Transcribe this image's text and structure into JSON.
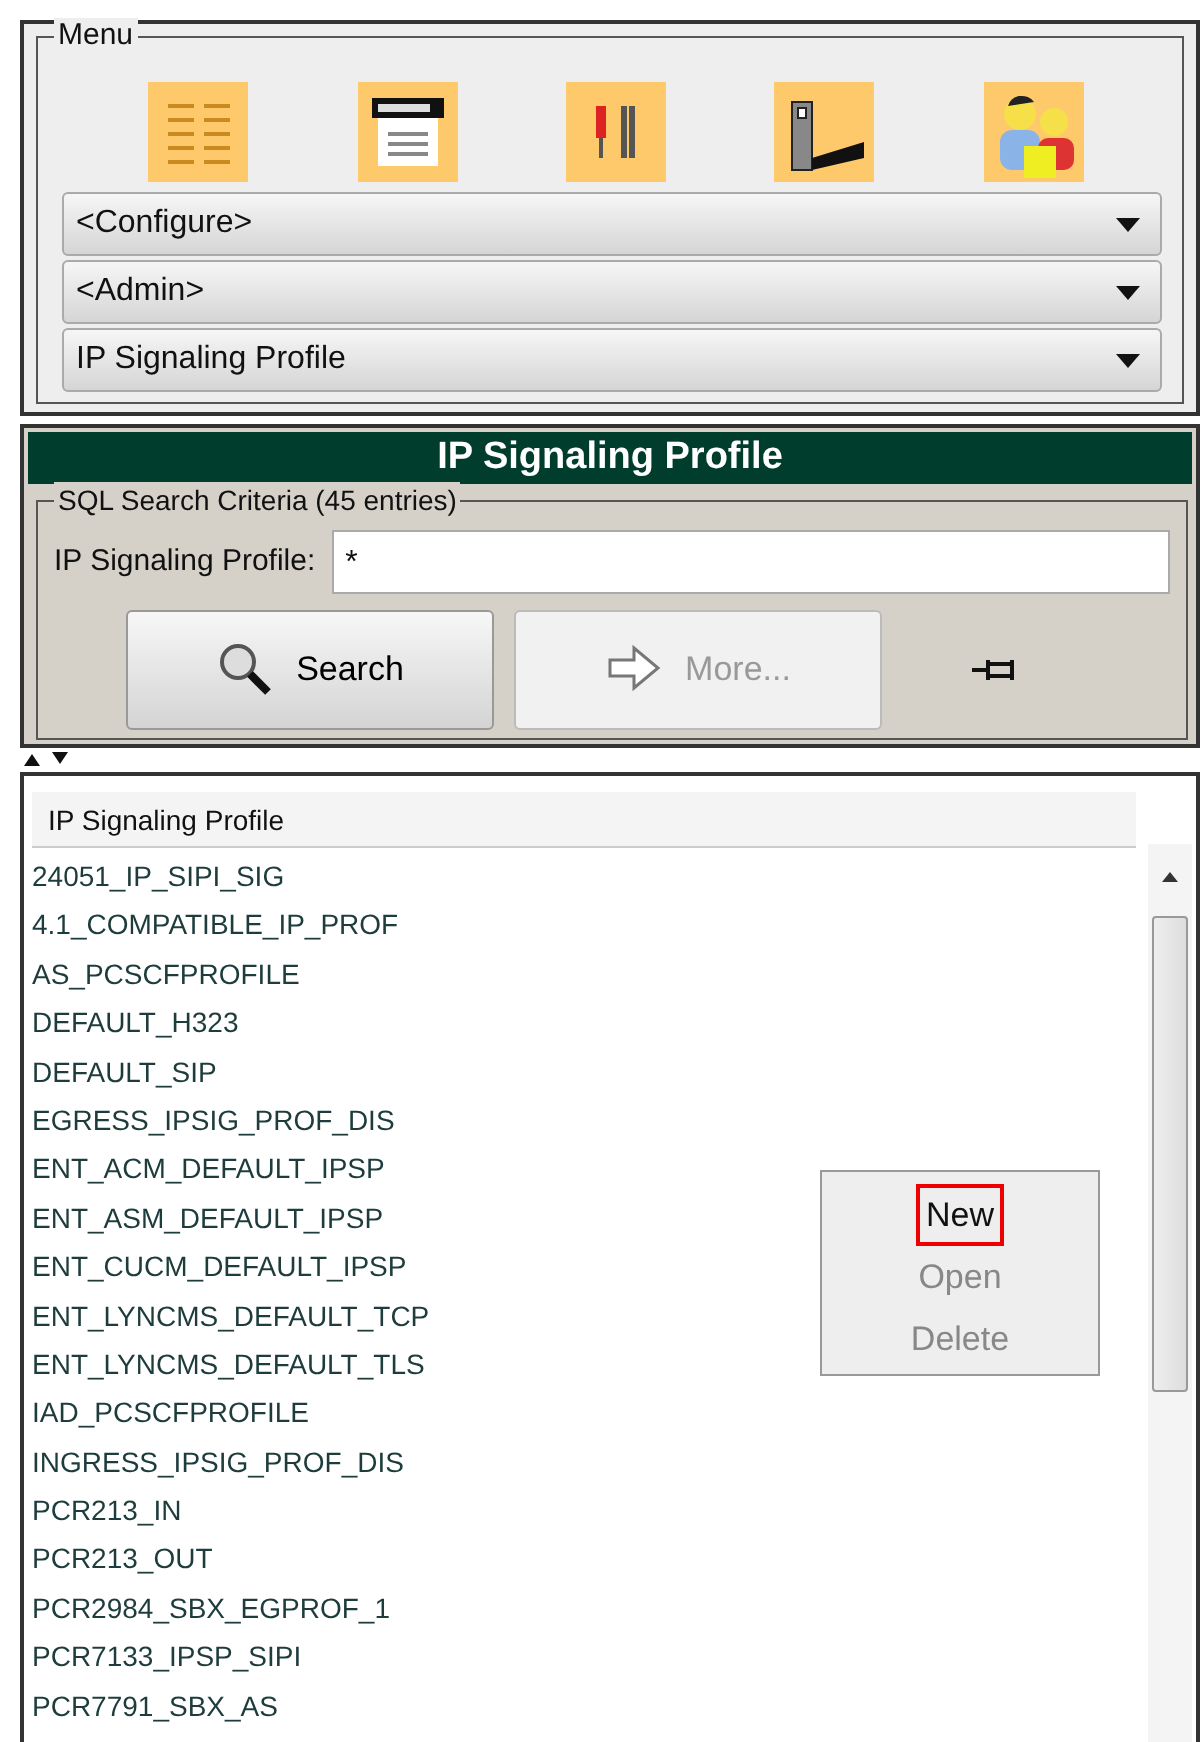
{
  "menu": {
    "title": "Menu",
    "icons": [
      {
        "kind": "list"
      },
      {
        "kind": "form"
      },
      {
        "kind": "tools"
      },
      {
        "kind": "device"
      },
      {
        "kind": "users"
      }
    ],
    "dropdowns": [
      {
        "value": "<Configure>"
      },
      {
        "value": "<Admin>"
      },
      {
        "value": "IP Signaling Profile"
      }
    ]
  },
  "panel": {
    "title": "IP Signaling Profile"
  },
  "search": {
    "title": "SQL Search Criteria (45 entries)",
    "label": "IP Signaling Profile:",
    "value": "*",
    "buttons": [
      {
        "kind": "search",
        "label": "Search",
        "disabled": false
      },
      {
        "kind": "more",
        "label": "More...",
        "disabled": true
      }
    ]
  },
  "table": {
    "columns": [
      "IP Signaling Profile"
    ],
    "rows": [
      "24051_IP_SIPI_SIG",
      "4.1_COMPATIBLE_IP_PROF",
      "AS_PCSCFPROFILE",
      "DEFAULT_H323",
      "DEFAULT_SIP",
      "EGRESS_IPSIG_PROF_DIS",
      "ENT_ACM_DEFAULT_IPSP",
      "ENT_ASM_DEFAULT_IPSP",
      "ENT_CUCM_DEFAULT_IPSP",
      "ENT_LYNCMS_DEFAULT_TCP",
      "ENT_LYNCMS_DEFAULT_TLS",
      "IAD_PCSCFPROFILE",
      "INGRESS_IPSIG_PROF_DIS",
      "PCR213_IN",
      "PCR213_OUT",
      "PCR2984_SBX_EGPROF_1",
      "PCR7133_IPSP_SIPI",
      "PCR7791_SBX_AS"
    ]
  },
  "context_menu": {
    "items": [
      {
        "label": "New",
        "disabled": false,
        "selected": true
      },
      {
        "label": "Open",
        "disabled": true,
        "selected": false
      },
      {
        "label": "Delete",
        "disabled": true,
        "selected": false
      }
    ]
  }
}
